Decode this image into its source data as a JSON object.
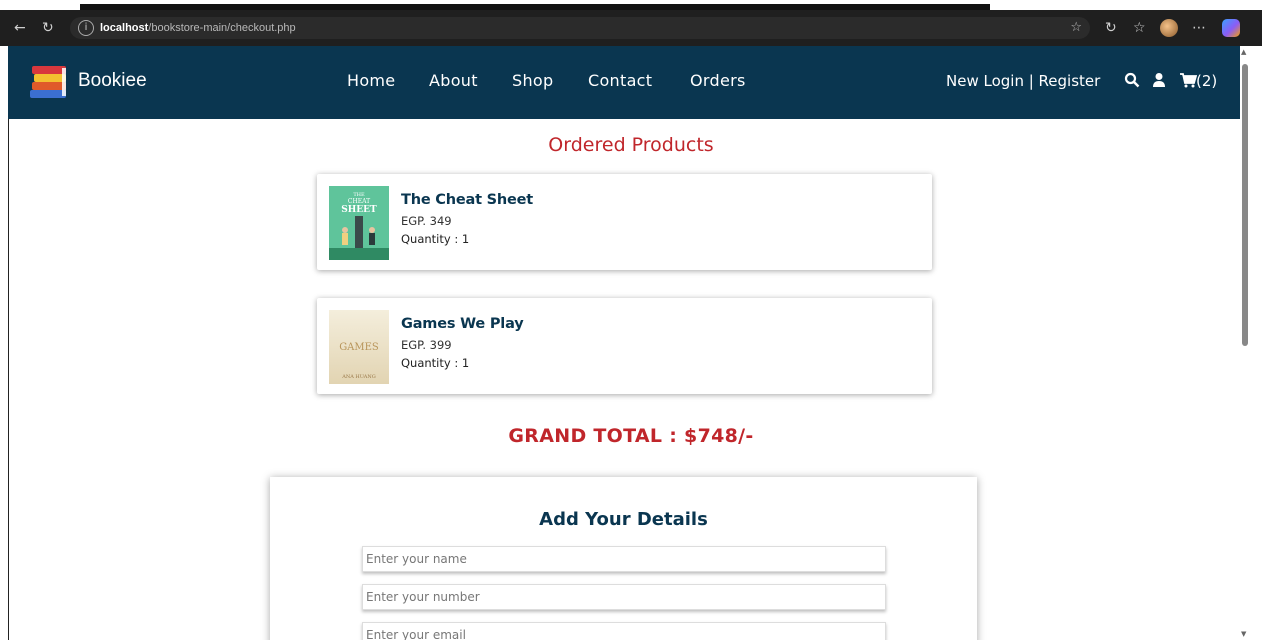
{
  "browser": {
    "url_host": "localhost",
    "url_path": "/bookstore-main/checkout.php",
    "back_icon": "arrow-left",
    "refresh_icon": "refresh",
    "info_icon": "info-circle",
    "favorite_icon": "star-outline",
    "more_icon": "ellipsis"
  },
  "header": {
    "brand": "Bookiee",
    "nav": [
      "Home",
      "About",
      "Shop",
      "Contact",
      "Orders"
    ],
    "login_register": "New Login | Register",
    "cart_count": "(2)",
    "bg_color": "#0a3650"
  },
  "ordered": {
    "title": "Ordered Products",
    "items": [
      {
        "name": "The Cheat Sheet",
        "price": "EGP. 349",
        "quantity": "Quantity : 1",
        "cover_text": [
          "THE",
          "CHEAT",
          "SHEET"
        ]
      },
      {
        "name": "Games We Play",
        "price": "EGP. 399",
        "quantity": "Quantity : 1",
        "cover_text": [
          "GAMES",
          "ANA HUANG"
        ]
      }
    ]
  },
  "grand_total": "GRAND TOTAL : $748/-",
  "details": {
    "title": "Add Your Details",
    "fields": [
      {
        "placeholder": "Enter your name",
        "value": ""
      },
      {
        "placeholder": "Enter your number",
        "value": ""
      },
      {
        "placeholder": "Enter your email",
        "value": ""
      }
    ]
  },
  "colors": {
    "accent_red": "#c0262b",
    "navy": "#0a3650"
  }
}
